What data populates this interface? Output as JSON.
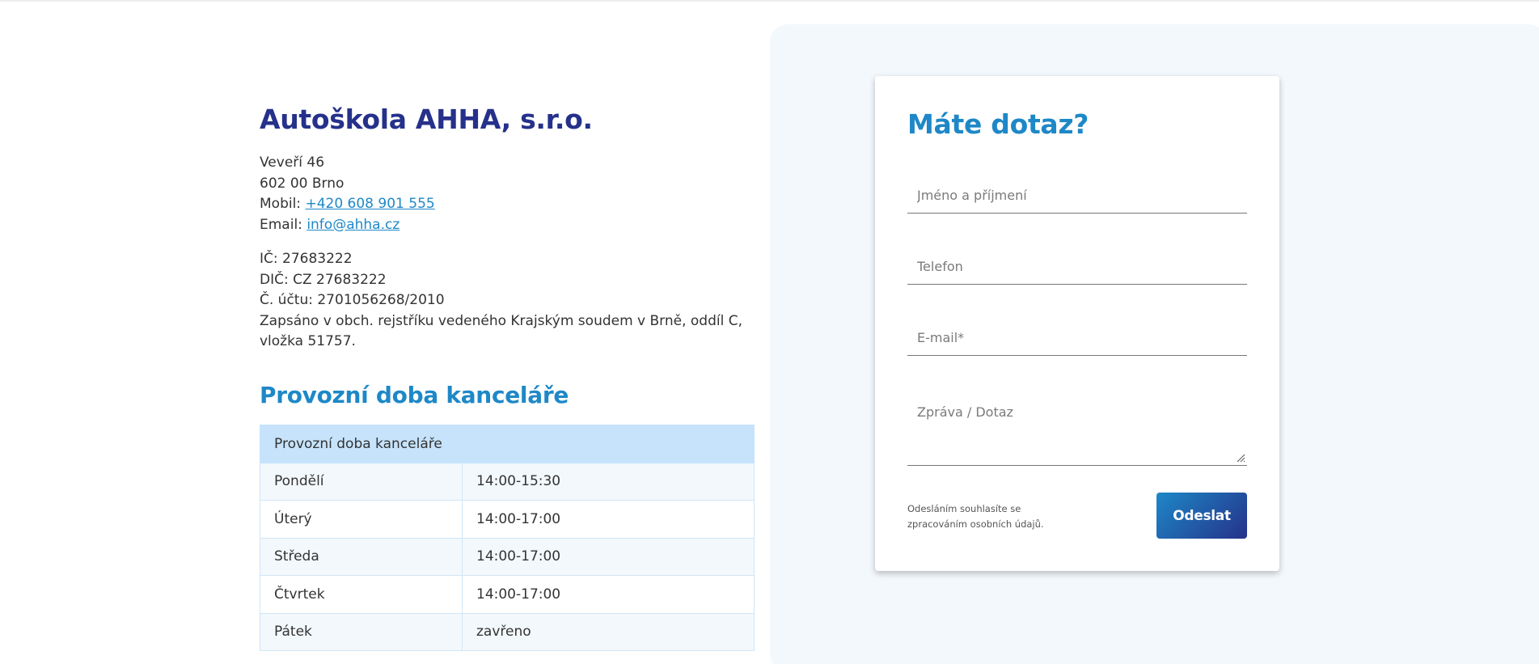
{
  "company": {
    "name": "Autoškola AHHA, s.r.o.",
    "street": "Veveří 46",
    "city": "602 00 Brno",
    "mobile_label": "Mobil:",
    "mobile": "+420 608 901 555",
    "email_label": "Email:",
    "email": "info@ahha.cz",
    "ic": "IČ: 27683222",
    "dic": "DIČ: CZ 27683222",
    "account": "Č. účtu: 2701056268/2010",
    "registry": "Zapsáno v obch. rejstříku vedeného Krajským soudem v Brně, oddíl C, vložka 51757."
  },
  "hours": {
    "title": "Provozní doba kanceláře",
    "table_header": "Provozní doba kanceláře",
    "rows": [
      {
        "day": "Pondělí",
        "time": "14:00-15:30"
      },
      {
        "day": "Úterý",
        "time": "14:00-17:00"
      },
      {
        "day": "Středa",
        "time": "14:00-17:00"
      },
      {
        "day": "Čtvrtek",
        "time": "14:00-17:00"
      },
      {
        "day": "Pátek",
        "time": "zavřeno"
      }
    ]
  },
  "form": {
    "title": "Máte dotaz?",
    "name_placeholder": "Jméno a příjmení",
    "phone_placeholder": "Telefon",
    "email_placeholder": "E-mail*",
    "message_placeholder": "Zpráva / Dotaz",
    "consent": "Odesláním souhlasíte se zpracováním osobních údajů.",
    "submit_label": "Odeslat"
  },
  "colors": {
    "navy": "#25318a",
    "accent_blue": "#1e88c7",
    "table_header_bg": "#c6e3fb",
    "panel_bg": "#f3f8fc"
  }
}
